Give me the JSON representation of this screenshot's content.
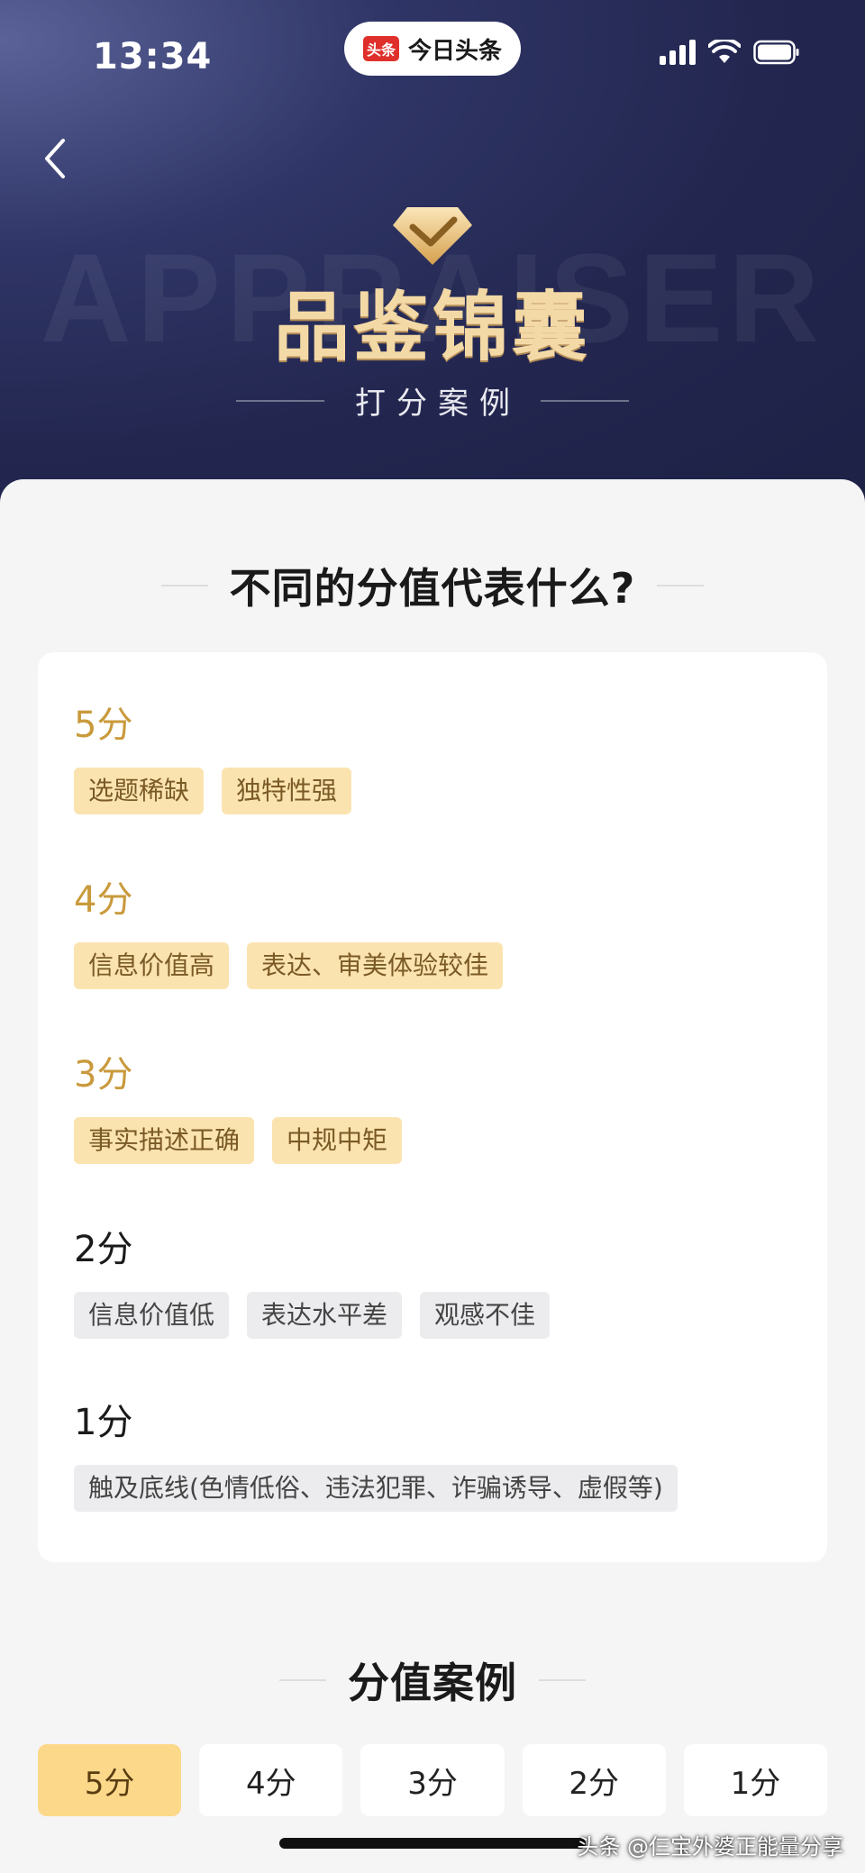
{
  "status_bar": {
    "time": "13:34",
    "app_logo_text": "头条",
    "app_name": "今日头条"
  },
  "hero": {
    "watermark": "APPRAISER",
    "title": "品鉴锦囊",
    "subtitle": "打分案例"
  },
  "section_scores": {
    "heading": "不同的分值代表什么?",
    "groups": [
      {
        "label": "5分",
        "tags": [
          "选题稀缺",
          "独特性强"
        ]
      },
      {
        "label": "4分",
        "tags": [
          "信息价值高",
          "表达、审美体验较佳"
        ]
      },
      {
        "label": "3分",
        "tags": [
          "事实描述正确",
          "中规中矩"
        ]
      },
      {
        "label": "2分",
        "tags": [
          "信息价值低",
          "表达水平差",
          "观感不佳"
        ]
      },
      {
        "label": "1分",
        "tags": [
          "触及底线(色情低俗、违法犯罪、诈骗诱导、虚假等)"
        ]
      }
    ]
  },
  "section_cases": {
    "heading": "分值案例",
    "tabs": [
      "5分",
      "4分",
      "3分",
      "2分",
      "1分"
    ],
    "active_tab": "5分"
  },
  "source_caption": "头条 @仨宝外婆正能量分享",
  "colors": {
    "gold_text": "#c99a3c",
    "gold_tag_bg": "#fbe3b0",
    "active_tab_bg": "#fcd98a",
    "hero_bg": "#232750"
  }
}
